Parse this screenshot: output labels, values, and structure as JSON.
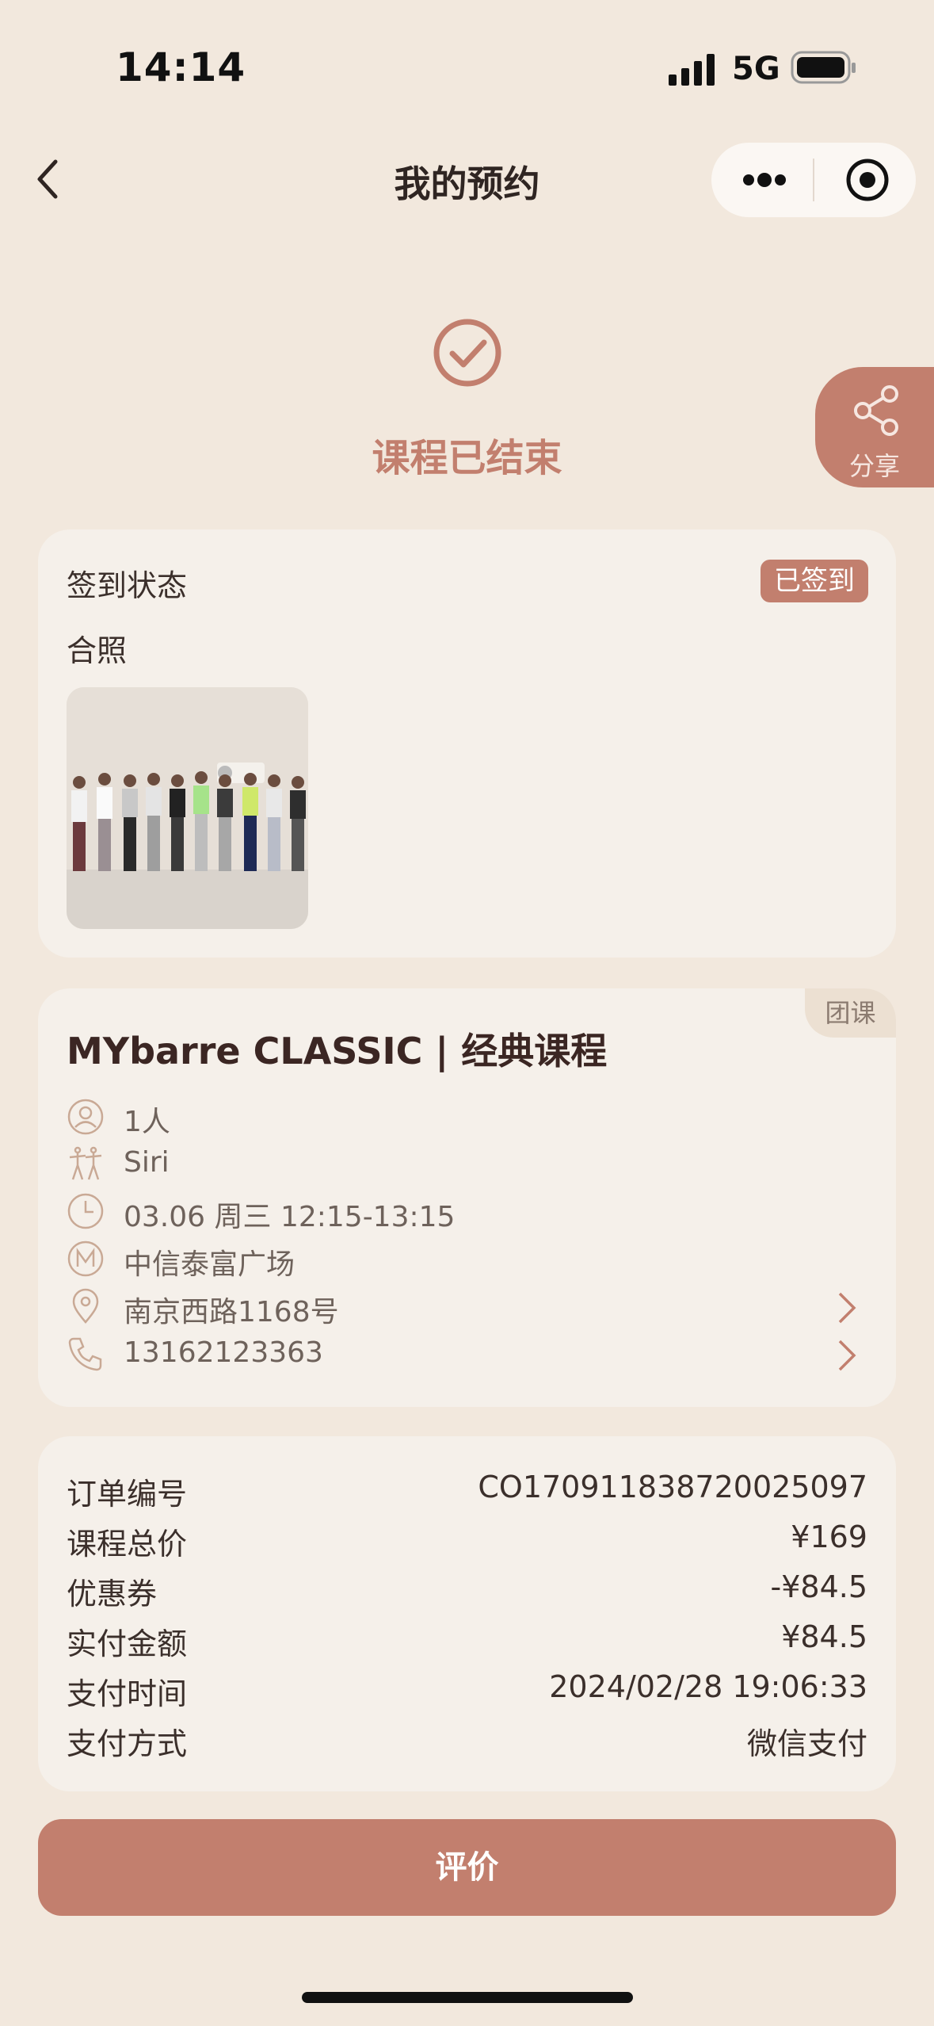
{
  "status_bar": {
    "time": "14:14",
    "network": "5G"
  },
  "nav": {
    "title": "我的预约",
    "back_icon": "chevron-left-icon",
    "more_icon": "more-dots-icon",
    "target_icon": "target-icon"
  },
  "status": {
    "text": "课程已结束",
    "icon": "check-circle-icon"
  },
  "share": {
    "label": "分享",
    "icon": "share-icon"
  },
  "checkin": {
    "label": "签到状态",
    "badge": "已签到",
    "photo_label": "合照"
  },
  "course": {
    "tag": "团课",
    "title": "MYbarre CLASSIC | 经典课程",
    "rows": [
      {
        "icon": "person-icon",
        "text": "1人"
      },
      {
        "icon": "dancer-icon",
        "text": "Siri"
      },
      {
        "icon": "clock-icon",
        "text": "03.06 周三 12:15-13:15"
      },
      {
        "icon": "m-logo-icon",
        "text": "中信泰富广场"
      },
      {
        "icon": "location-pin-icon",
        "text": "南京西路1168号"
      },
      {
        "icon": "phone-icon",
        "text": "13162123363"
      }
    ]
  },
  "order": {
    "rows": [
      {
        "label": "订单编号",
        "value": "CO170911838720025097"
      },
      {
        "label": "课程总价",
        "value": "¥169"
      },
      {
        "label": "优惠券",
        "value": "-¥84.5"
      },
      {
        "label": "实付金额",
        "value": "¥84.5"
      },
      {
        "label": "支付时间",
        "value": "2024/02/28 19:06:33"
      },
      {
        "label": "支付方式",
        "value": "微信支付"
      }
    ]
  },
  "action": {
    "label": "评价"
  },
  "colors": {
    "accent": "#c27f6e",
    "background": "#f2e8dd",
    "card": "#f5f0ea"
  }
}
